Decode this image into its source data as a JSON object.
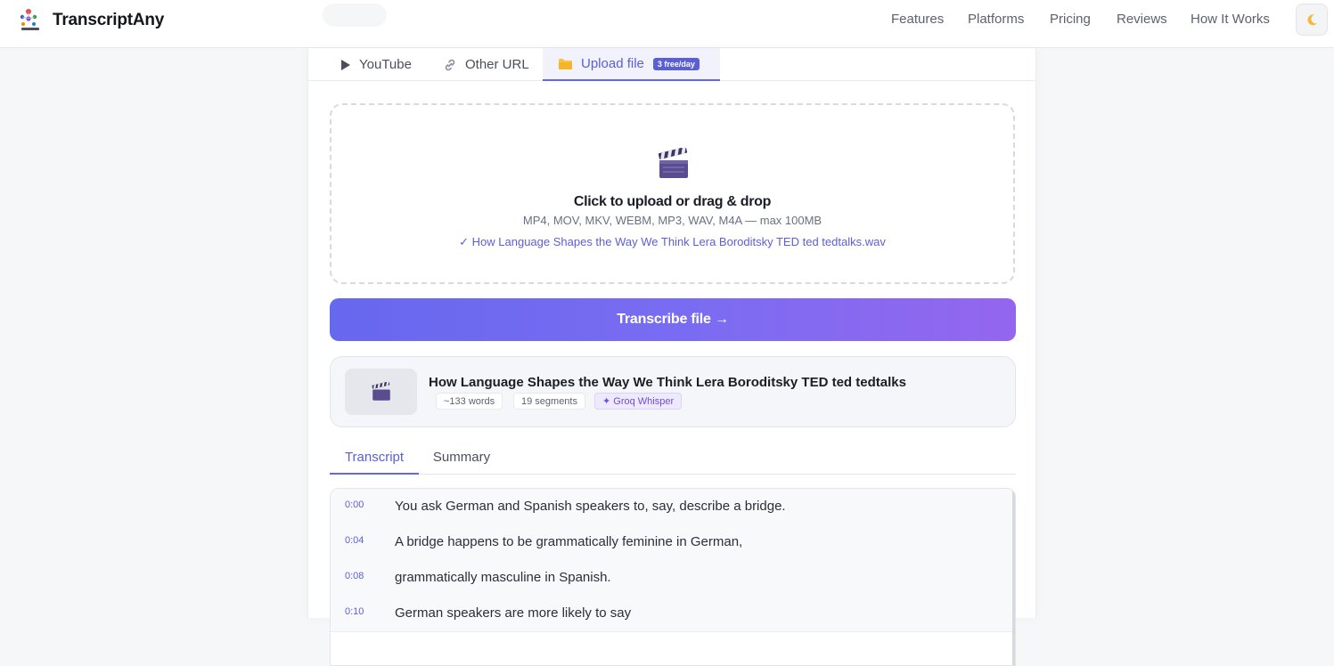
{
  "header": {
    "app_name": "TranscriptAny",
    "nav": [
      "Features",
      "Platforms",
      "Pricing",
      "Reviews",
      "How It Works"
    ],
    "theme_icon": "moon-icon"
  },
  "source_tabs": {
    "youtube": "YouTube",
    "other_url": "Other URL",
    "upload_file": "Upload file",
    "upload_badge": "3 free/day",
    "active": "upload_file"
  },
  "dropzone": {
    "icon": "clapper-board-icon",
    "title": "Click to upload or drag & drop",
    "formats": "MP4, MOV, MKV, WEBM, MP3, WAV, M4A — max 100MB",
    "selected_file": "✓ How Language Shapes the Way We Think Lera Boroditsky TED ted tedtalks.wav"
  },
  "transcribe_button": "Transcribe file →",
  "result": {
    "title": "How Language Shapes the Way We Think Lera Boroditsky TED ted tedtalks",
    "words": "~133 words",
    "segments": "19 segments",
    "engine": "✦ Groq Whisper"
  },
  "view_tabs": {
    "transcript": "Transcript",
    "summary": "Summary",
    "active": "transcript"
  },
  "transcript": [
    {
      "time": "0:00",
      "text": "You ask German and Spanish speakers to, say, describe a bridge."
    },
    {
      "time": "0:04",
      "text": "A bridge happens to be grammatically feminine in German,"
    },
    {
      "time": "0:08",
      "text": "grammatically masculine in Spanish."
    },
    {
      "time": "0:10",
      "text": "German speakers are more likely to say"
    }
  ],
  "colors": {
    "accent": "#6366f1",
    "button_gradient_start": "#6668ee",
    "button_gradient_end": "#9466ee",
    "groq_chip": "#6d4fd9"
  }
}
